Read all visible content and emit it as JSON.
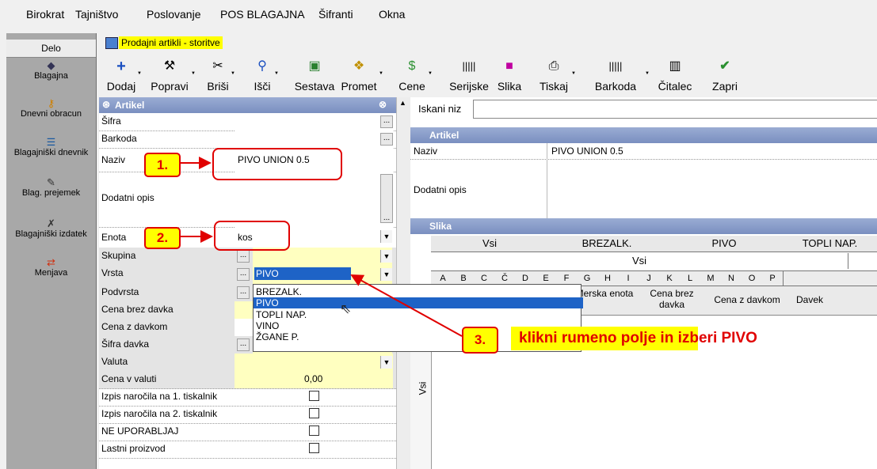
{
  "menubar": [
    "Birokrat",
    "Tajništvo",
    "Poslovanje",
    "POS BLAGAJNA",
    "Šifranti",
    "Okna"
  ],
  "left_panel": {
    "tab": "Delo",
    "items": [
      {
        "label": "Blagajna",
        "icon": "cash-register-icon"
      },
      {
        "label": "Dnevni obracun",
        "icon": "key-icon"
      },
      {
        "label": "Blagajniški dnevnik",
        "icon": "journal-icon"
      },
      {
        "label": "Blag. prejemek",
        "icon": "receipt-in-icon"
      },
      {
        "label": "Blagajniški izdatek",
        "icon": "receipt-out-icon"
      },
      {
        "label": "Menjava",
        "icon": "exchange-icon"
      }
    ]
  },
  "window": {
    "title": "Prodajni artikli - storitve"
  },
  "toolbar": [
    {
      "label": "Dodaj",
      "icon": "plus-icon",
      "drop": true
    },
    {
      "label": "Popravi",
      "icon": "hammer-icon",
      "drop": true
    },
    {
      "label": "Briši",
      "icon": "scissors-icon",
      "drop": true
    },
    {
      "label": "Išči",
      "icon": "search-icon",
      "drop": true
    },
    {
      "label": "Sestava",
      "icon": "assembly-icon",
      "drop": false
    },
    {
      "label": "Promet",
      "icon": "turnover-icon",
      "drop": true
    },
    {
      "label": "Cene",
      "icon": "dollar-icon",
      "drop": true
    },
    {
      "label": "Serijske",
      "icon": "serial-icon",
      "drop": false
    },
    {
      "label": "Slika",
      "icon": "image-icon",
      "drop": false
    },
    {
      "label": "Tiskaj",
      "icon": "printer-icon",
      "drop": true
    },
    {
      "label": "Barkoda",
      "icon": "barcode-icon",
      "drop": true
    },
    {
      "label": "Čitalec",
      "icon": "reader-icon",
      "drop": false
    },
    {
      "label": "Zapri",
      "icon": "check-icon",
      "drop": false
    }
  ],
  "form": {
    "header": "Artikel",
    "rows": [
      {
        "label": "Šifra",
        "value": ""
      },
      {
        "label": "Barkoda",
        "value": ""
      },
      {
        "label": "Naziv",
        "value": "PIVO UNION 0.5"
      },
      {
        "label": "Dodatni opis",
        "value": ""
      },
      {
        "label": "Enota",
        "value": "kos"
      },
      {
        "label": "Skupina",
        "value": ""
      },
      {
        "label": "Vrsta",
        "value": "PIVO"
      },
      {
        "label": "Podvrsta",
        "value": ""
      },
      {
        "label": "Cena brez davka",
        "value": ""
      },
      {
        "label": "Cena z davkom",
        "value": ""
      },
      {
        "label": "Šifra davka",
        "value": ""
      },
      {
        "label": "Valuta",
        "value": ""
      },
      {
        "label": "Cena v valuti",
        "value": "0,00"
      },
      {
        "label": "Izpis naročila na 1. tiskalnik",
        "value": ""
      },
      {
        "label": "Izpis naročila na 2. tiskalnik",
        "value": ""
      },
      {
        "label": "NE UPORABLJAJ",
        "value": ""
      },
      {
        "label": "Lastni proizvod",
        "value": ""
      }
    ]
  },
  "right": {
    "search_label": "Iskani niz",
    "artikel_header": "Artikel",
    "naziv_label": "Naziv",
    "naziv_value": "PIVO UNION 0.5",
    "opis_label": "Dodatni opis",
    "slika_header": "Slika",
    "tabs": [
      "Vsi",
      "BREZALK.",
      "PIVO",
      "TOPLI NAP."
    ],
    "subtab": "Vsi",
    "letters": [
      "A",
      "B",
      "C",
      "Č",
      "D",
      "E",
      "F",
      "G",
      "H",
      "I",
      "J",
      "K",
      "L",
      "M",
      "N",
      "O",
      "P"
    ],
    "columns": [
      "Merska enota",
      "Cena brez davka",
      "Cena z davkom",
      "Davek"
    ],
    "side_label": "Vsi"
  },
  "dropdown": {
    "options": [
      "BREZALK.",
      "PIVO",
      "TOPLI NAP.",
      "VINO",
      "ŽGANE P."
    ],
    "selected": "PIVO"
  },
  "annotations": {
    "step1": "1.",
    "step2": "2.",
    "step3": "3.",
    "text_pre": "klikni ",
    "text_hl": "rumeno polje",
    "text_post": " in izberi PIVO"
  },
  "colors": {
    "accent": "#e00000",
    "highlight": "#ffff00",
    "header": "#8a9dcb",
    "selection": "#1e63c6"
  }
}
